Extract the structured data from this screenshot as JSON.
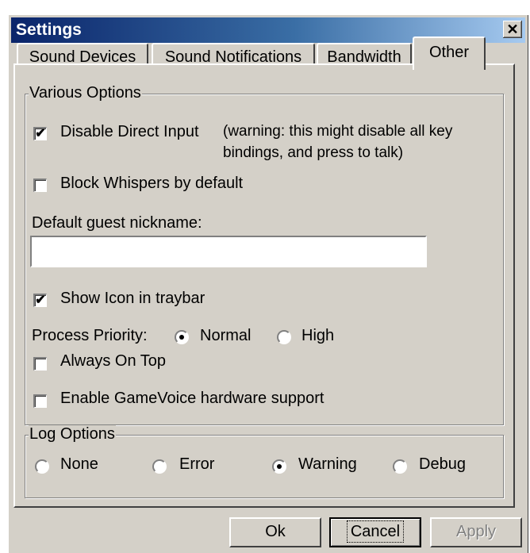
{
  "window": {
    "title": "Settings",
    "close_glyph": "✕"
  },
  "tabs": [
    {
      "label": "Sound Devices",
      "active": false
    },
    {
      "label": "Sound Notifications",
      "active": false
    },
    {
      "label": "Bandwidth",
      "active": false
    },
    {
      "label": "Other",
      "active": true
    }
  ],
  "various_options": {
    "group_label": "Various Options",
    "disable_direct_input": {
      "label": "Disable Direct Input",
      "checked": true,
      "warning_line1": "(warning: this might disable all key",
      "warning_line2": "bindings, and press to talk)"
    },
    "block_whispers": {
      "label": "Block Whispers by default",
      "checked": false
    },
    "guest_nickname": {
      "label": "Default guest nickname:",
      "value": ""
    },
    "show_icon_traybar": {
      "label": "Show Icon in traybar",
      "checked": true
    },
    "process_priority": {
      "label": "Process Priority:",
      "options": [
        "Normal",
        "High"
      ],
      "selected": "Normal"
    },
    "always_on_top": {
      "label": "Always On Top",
      "checked": false
    },
    "gamevoice": {
      "label": "Enable GameVoice hardware support",
      "checked": false
    }
  },
  "log_options": {
    "group_label": "Log Options",
    "options": [
      "None",
      "Error",
      "Warning",
      "Debug"
    ],
    "selected": "Warning"
  },
  "buttons": {
    "ok": "Ok",
    "cancel": "Cancel",
    "apply": "Apply"
  },
  "check_glyph": "✔"
}
